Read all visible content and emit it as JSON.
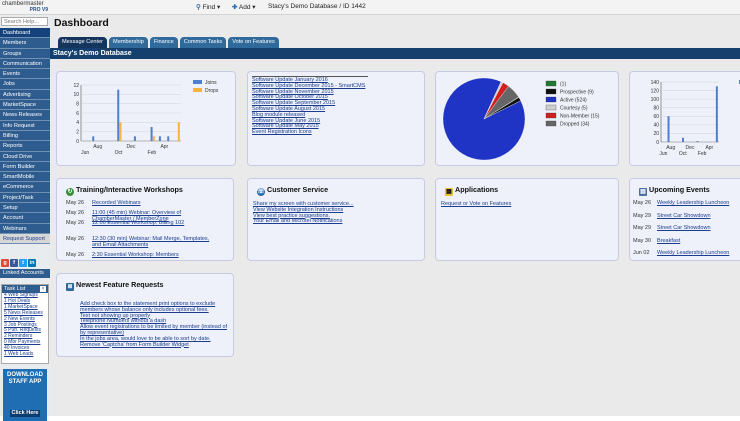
{
  "header": {
    "logo_top": "chambermaster",
    "logo_bottom": "PRO V9",
    "find_label": "Find",
    "add_label": "Add",
    "db_title": "Stacy's Demo Database / ID 1442"
  },
  "sidebar": {
    "search_placeholder": "Search Help...",
    "items": [
      "Dashboard",
      "Members",
      "Groups",
      "Communication",
      "Events",
      "Jobs",
      "Advertising",
      "MarketSpace",
      "News Releases",
      "Info Request",
      "Billing",
      "Reports",
      "Cloud Drive",
      "Form Builder",
      "SmartMobile",
      "eCommerce",
      "Project/Task",
      "Setup",
      "Account",
      "Webinars",
      "Request Support"
    ],
    "linked_accounts": "Linked Accounts"
  },
  "tasklist": {
    "title": "Task List",
    "items": [
      "4 Web Signups",
      "1 Hot Deals",
      "1 MarketSpace",
      "5 News Releases",
      "2 New Events",
      "3 Job Postings",
      "5 Pub. Requests",
      "2 Reminders",
      "0 Mbr Payments",
      "40 Invoices",
      "1 Web Leads"
    ]
  },
  "app_ad": {
    "line1": "DOWNLOAD",
    "line2": "STAFF APP",
    "click": "Click Here"
  },
  "main": {
    "title": "Dashboard",
    "tabs": [
      "Message Center",
      "Membership",
      "Finance",
      "Common Tasks",
      "Vote on Features"
    ],
    "db_bar": "Stacy's Demo Database"
  },
  "chart1": {
    "legend": [
      {
        "label": "Joins",
        "color": "#4f7fcf"
      },
      {
        "label": "Drops",
        "color": "#f5b342"
      }
    ],
    "x_top": [
      "Aug",
      "Dec",
      "Apr"
    ],
    "x_bottom": [
      "Jun",
      "Oct",
      "Feb"
    ]
  },
  "updates": [
    "Software Update January 2016",
    "Software Update December 2015 - SmartCMS",
    "Software Update November 2015",
    "Software Update October 2015",
    "Software Update September 2015",
    "Software Update August 2015",
    "Blog module released",
    "Software Update June 2015",
    "Software Update May 2015",
    "Event Registration Icons"
  ],
  "pie_legend": [
    {
      "label": "(1)",
      "color": "#1f7a2f"
    },
    {
      "label": "Prospective (9)",
      "color": "#111111"
    },
    {
      "label": "Active (524)",
      "color": "#1f33c4"
    },
    {
      "label": "Courtesy (5)",
      "color": "#cfcfcf"
    },
    {
      "label": "Non-Member (15)",
      "color": "#d41e1e"
    },
    {
      "label": "Dropped (34)",
      "color": "#666666"
    }
  ],
  "training": {
    "title": "Training/Interactive Workshops",
    "items": [
      {
        "date": "May 26",
        "text": "Recorded Webinars"
      },
      {
        "date": "May 26",
        "text": "11:00 (45 min) Webinar: Overview of ChamberMaster / MemberZone"
      },
      {
        "date": "May 26",
        "text": "12:00 Essential Workshop: Billing 102"
      },
      {
        "date": "May 26",
        "text": "12:30 (30 min) Webinar: Mail Merge, Templates, and Email Attachments"
      },
      {
        "date": "May 26",
        "text": "2:30 Essential Workshop: Members"
      }
    ]
  },
  "customer": {
    "title": "Customer Service",
    "links": [
      "Share my screen with customer service...",
      "View Website Integration Instructions",
      "View best practice suggestions.",
      "Your Email and Microtel Notifications"
    ]
  },
  "applications": {
    "title": "Applications",
    "link": "Request or Vote on Features"
  },
  "upcoming": {
    "title": "Upcoming Events",
    "items": [
      {
        "date": "May 26",
        "text": "Weekly Leadership Luncheon"
      },
      {
        "date": "May 29",
        "text": "Street Car Showdown"
      },
      {
        "date": "May 29",
        "text": "Street Car Showdown"
      },
      {
        "date": "May 30",
        "text": "Breakfast"
      },
      {
        "date": "Jun 02",
        "text": "Weekly Leadership Luncheon"
      }
    ]
  },
  "features": {
    "title": "Newest Feature Requests",
    "items": [
      "Add check box to the statement print options to exclude members whose balance only includes optional fees.",
      "Text not showing up properly",
      "Telephone Numbers without a dash",
      "Allow event registrations to be limited by member (instead of by representative)",
      "In the jobs area, would love to be able to sort by date.",
      "Remove 'Captcha' from Form Builder Widget"
    ]
  },
  "chart_data": [
    {
      "type": "bar",
      "series": [
        {
          "name": "Joins",
          "values": [
            0,
            1,
            0,
            0,
            11,
            0,
            1,
            0,
            3,
            1,
            1,
            0
          ]
        },
        {
          "name": "Drops",
          "values": [
            0,
            0,
            0,
            0,
            4,
            0,
            0,
            0,
            1,
            0,
            0,
            4
          ]
        }
      ],
      "ylim": [
        0,
        12
      ],
      "yticks": [
        0,
        2,
        4,
        6,
        8,
        10,
        12
      ]
    },
    {
      "type": "pie",
      "values": [
        1,
        9,
        524,
        5,
        15,
        34
      ]
    },
    {
      "type": "bar",
      "series": [
        {
          "name": "Joins",
          "values": [
            0,
            60,
            0,
            0,
            10,
            0,
            0,
            2,
            0,
            0,
            0,
            130
          ]
        }
      ],
      "ylim": [
        0,
        140
      ],
      "yticks": [
        0,
        20,
        40,
        60,
        80,
        100,
        120,
        140
      ],
      "x_top": [
        "Aug",
        "Dec",
        "Apr"
      ],
      "x_bottom": [
        "Jun",
        "Oct",
        "Feb"
      ]
    }
  ]
}
